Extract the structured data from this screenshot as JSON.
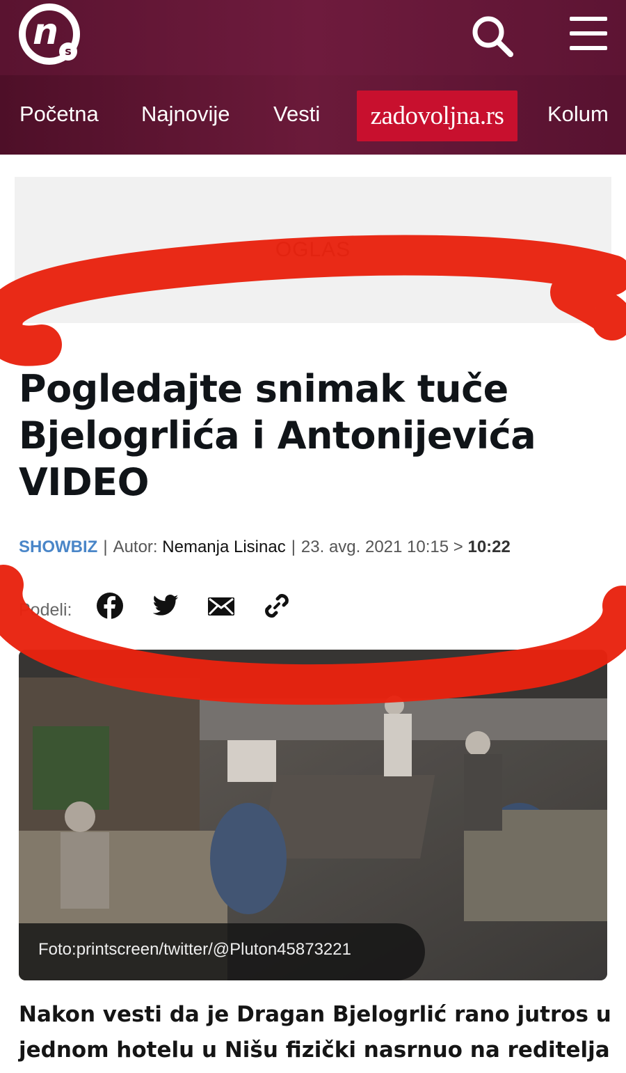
{
  "header": {
    "logo_letter": "n",
    "logo_sub": "s",
    "nav": [
      "Početna",
      "Najnovije",
      "Vesti",
      "Kolum"
    ],
    "partner_label": "zadovoljna.rs"
  },
  "ad": {
    "label": "OGLAS"
  },
  "article": {
    "headline": "Pogledajte snimak tuče Bjelogrlića i Antonijevića VIDEO",
    "category": "SHOWBIZ",
    "author_label": "Autor:",
    "author": "Nemanja Lisinac",
    "published": "23. avg. 2021 10:15",
    "arrow": ">",
    "updated": "10:22",
    "share_label": "Podeli:",
    "photo_caption": "Foto:printscreen/twitter/@Pluton45873221",
    "lead": "Nakon vesti da je Dragan Bjelogrlić rano jutros u jednom hotelu u Nišu fizički nasrnuo na reditelja"
  },
  "colors": {
    "header_bg": "#6b1a3a",
    "partner_bg": "#c8102e",
    "category": "#4a86c8",
    "marker": "#e8230f"
  },
  "icons": [
    "search-icon",
    "menu-icon",
    "facebook-icon",
    "twitter-icon",
    "mail-icon",
    "link-icon"
  ]
}
